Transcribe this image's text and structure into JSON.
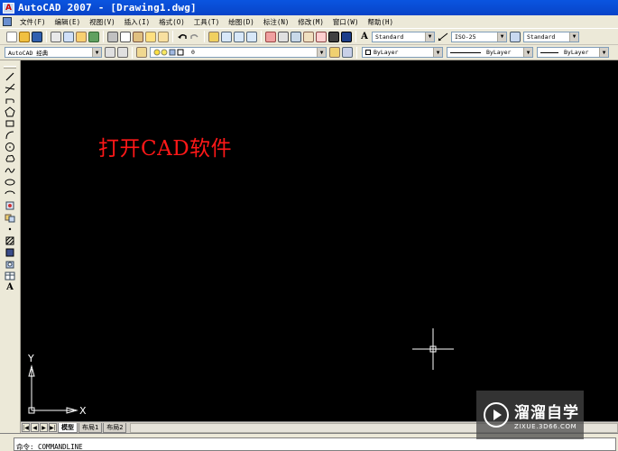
{
  "window": {
    "title": "AutoCAD 2007 - [Drawing1.dwg]"
  },
  "menu": [
    "文件(F)",
    "编辑(E)",
    "视图(V)",
    "插入(I)",
    "格式(O)",
    "工具(T)",
    "绘图(D)",
    "标注(N)",
    "修改(M)",
    "窗口(W)",
    "帮助(H)"
  ],
  "toolbar": {
    "text_style": "Standard",
    "dim_style": "ISO-25",
    "table_style": "Standard",
    "workspace": "AutoCAD 经典",
    "layer": "0",
    "color": "ByLayer",
    "linetype": "ByLayer",
    "lineweight": "ByLayer"
  },
  "canvas": {
    "annotation": "打开CAD软件",
    "ucs_x": "X",
    "ucs_y": "Y",
    "background": "#000000",
    "annotation_color": "#ff1818"
  },
  "layout_tabs": [
    "模型",
    "布局1",
    "布局2"
  ],
  "command_line": {
    "text": "命令: COMMANDLINE"
  },
  "watermark": {
    "brand": "溜溜自学",
    "site": "ZIXUE.3D66.COM"
  }
}
